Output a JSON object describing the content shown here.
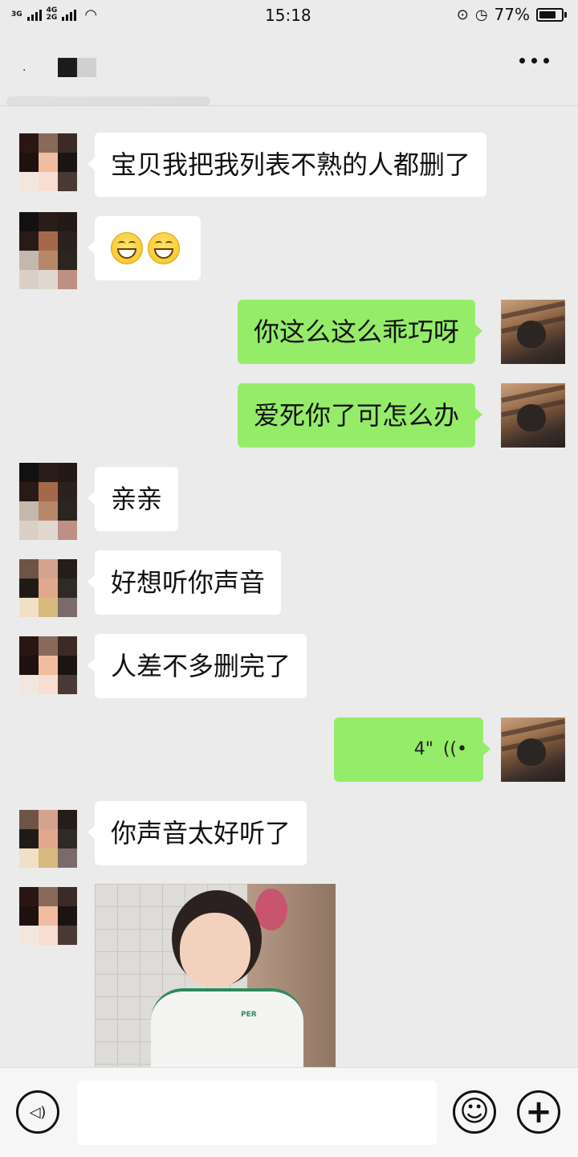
{
  "status_bar": {
    "network_top": "3G",
    "network_mid": "4G",
    "network_bottom": "2G",
    "time": "15:18",
    "battery_percent": "77%",
    "battery_level": 0.77
  },
  "header": {
    "back_glyph": "·",
    "more_icon": "more-dots-icon"
  },
  "messages": [
    {
      "side": "left",
      "text": "宝贝我把我列表不熟的人都删了"
    },
    {
      "side": "left",
      "emoji": [
        "grinning-face-icon",
        "grinning-face-icon"
      ]
    },
    {
      "side": "right",
      "text": "你这么这么乖巧呀"
    },
    {
      "side": "right",
      "text": "爱死你了可怎么办"
    },
    {
      "side": "left",
      "text": "亲亲"
    },
    {
      "side": "left",
      "text": "好想听你声音"
    },
    {
      "side": "left",
      "text": "人差不多删完了"
    },
    {
      "side": "right",
      "voice_length": "4\"",
      "voice_icon": "voice-wave-icon"
    },
    {
      "side": "left",
      "text": "你声音太好听了"
    },
    {
      "side": "left",
      "photo": "child-photo",
      "shirt_text": "PER"
    }
  ],
  "input_bar": {
    "voice_button_icon": "voice-mode-icon",
    "voice_glyph": "◁)",
    "emoji_button_icon": "smiley-icon",
    "emoji_glyph": "☺",
    "plus_button_icon": "plus-icon",
    "plus_glyph": "+"
  },
  "colors": {
    "background": "#ebebeb",
    "bubble_left": "#ffffff",
    "bubble_right": "#95ec69"
  }
}
